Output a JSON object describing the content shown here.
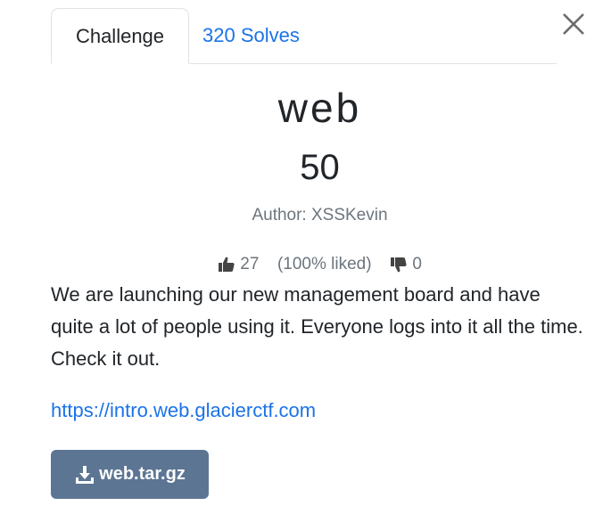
{
  "tabs": {
    "challenge": "Challenge",
    "solves": "320 Solves"
  },
  "challenge": {
    "name": "web",
    "points": "50",
    "author": "Author: XSSKevin",
    "likes": "27",
    "like_pct": "(100% liked)",
    "dislikes": "0",
    "description": "We are launching our new management board and have quite a lot of people using it. Everyone logs into it all the time. Check it out.",
    "link": "https://intro.web.glacierctf.com",
    "file": "web.tar.gz"
  },
  "colors": {
    "link": "#1a73e8",
    "button": "#5c7593"
  },
  "icons": {
    "close": "close-icon",
    "like": "thumbs-up-icon",
    "dislike": "thumbs-down-icon",
    "download": "download-icon"
  }
}
